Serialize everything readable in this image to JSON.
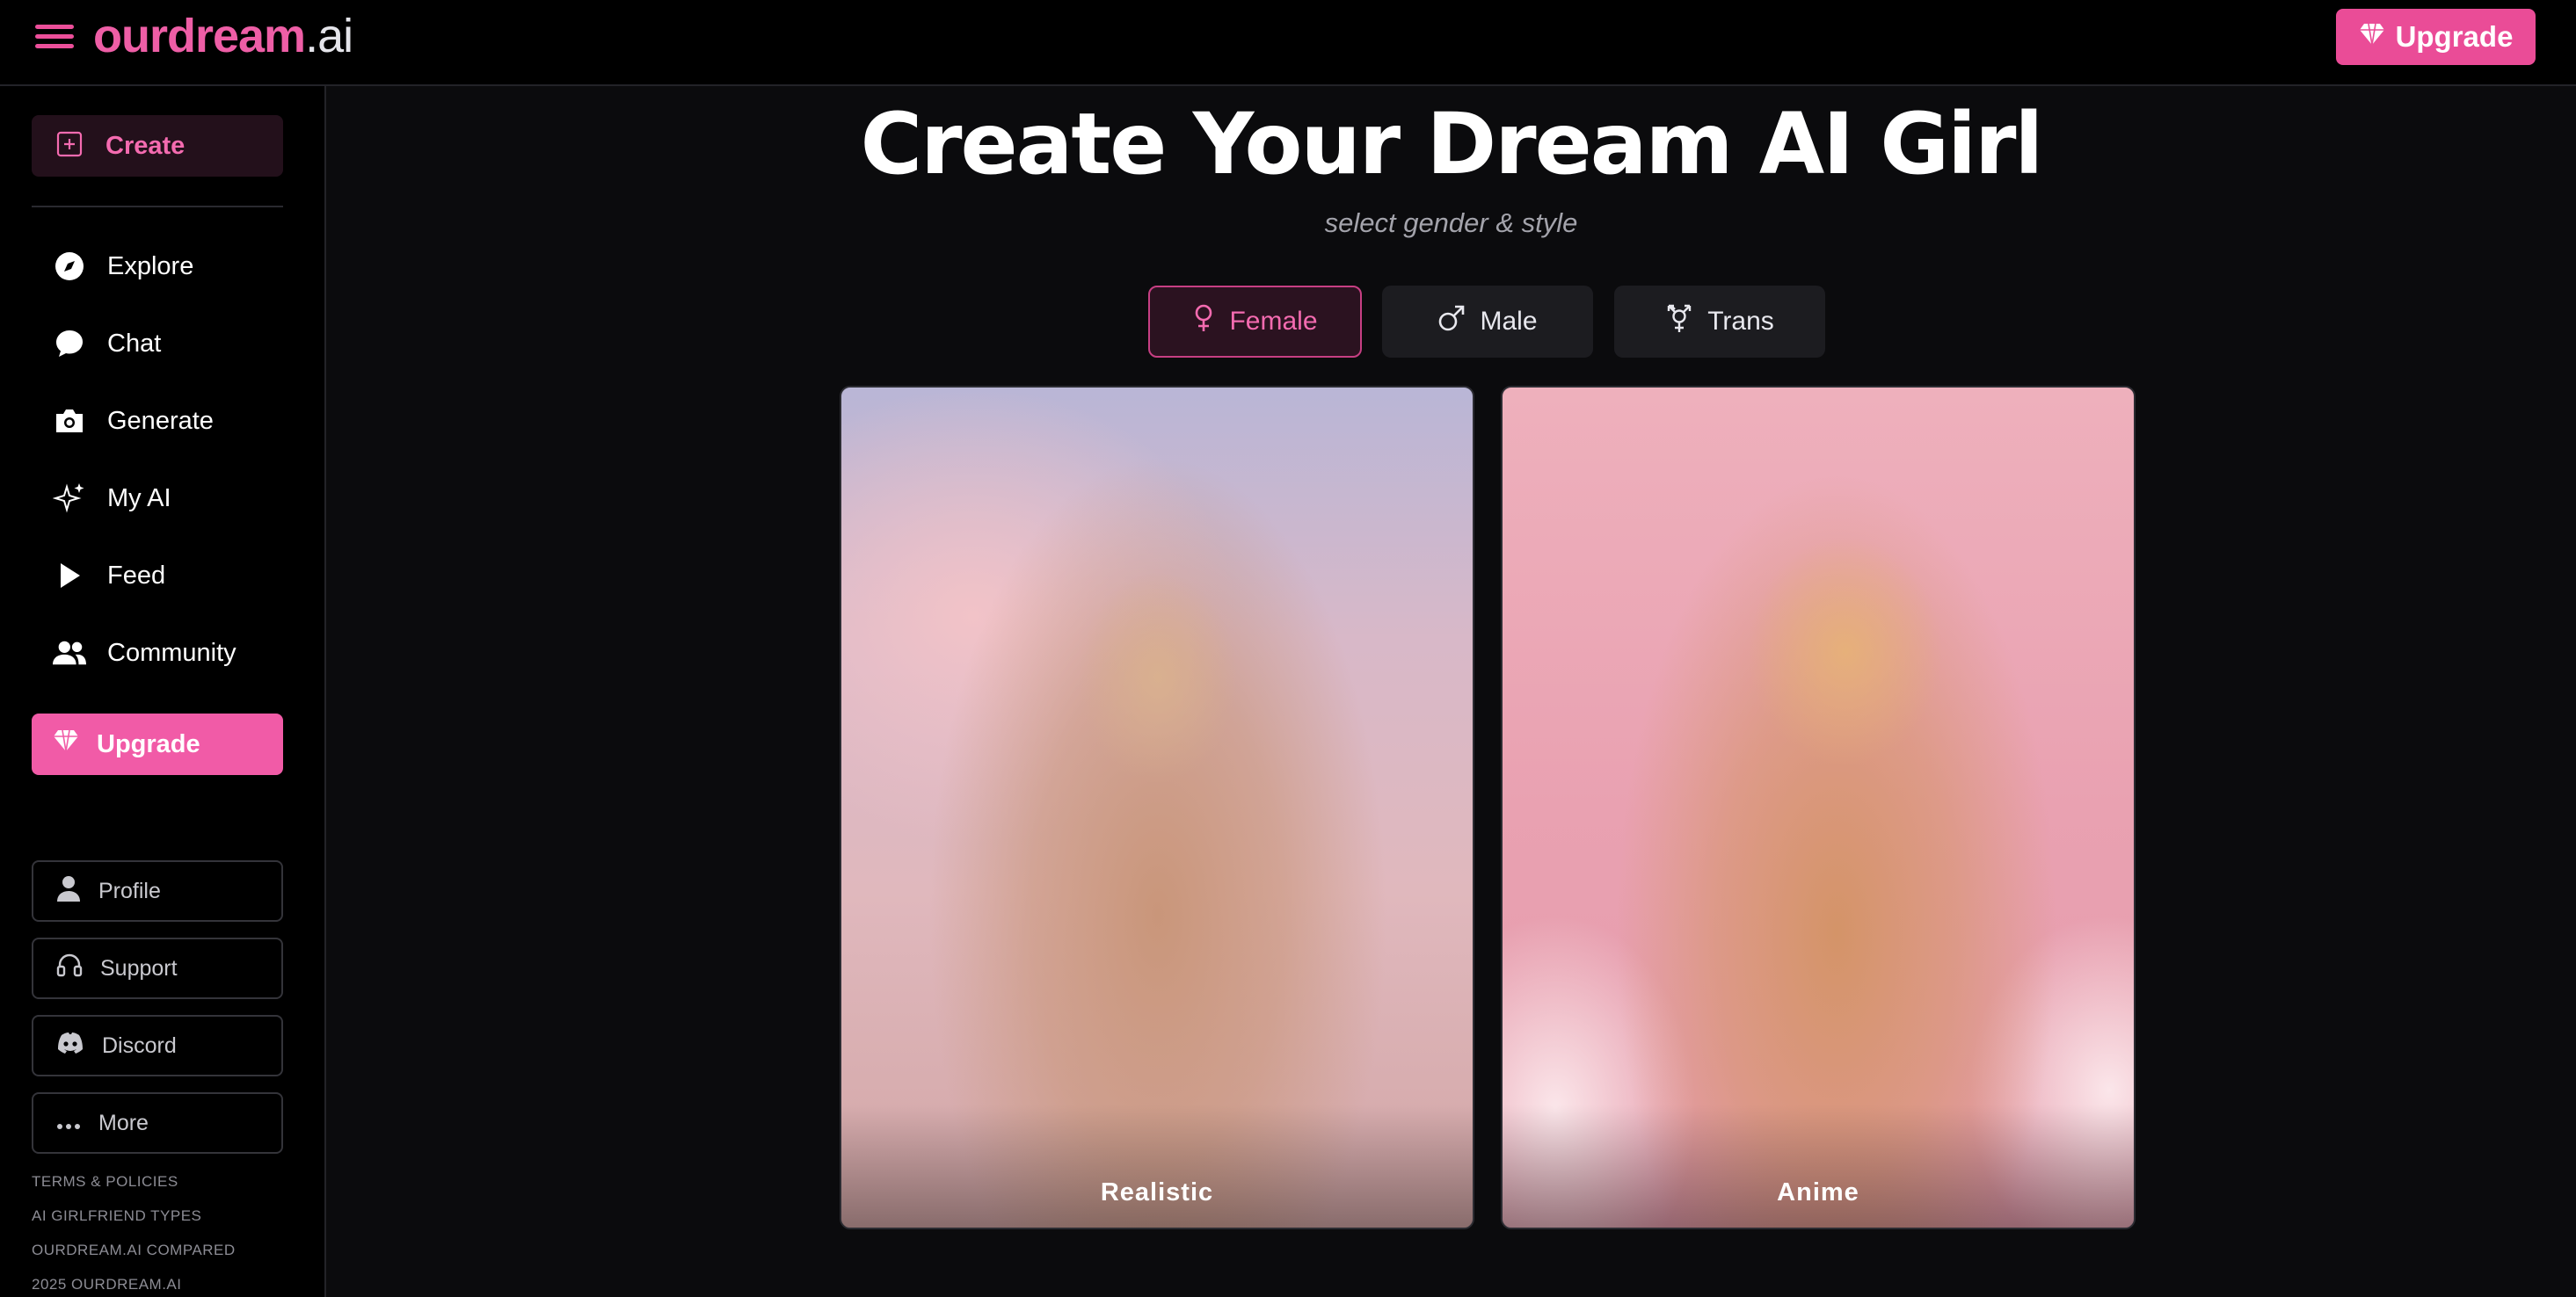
{
  "header": {
    "logo_main": "ourdream",
    "logo_tld": ".ai",
    "upgrade_label": "Upgrade"
  },
  "sidebar": {
    "create_label": "Create",
    "nav": [
      {
        "label": "Explore",
        "icon": "compass-icon"
      },
      {
        "label": "Chat",
        "icon": "chat-bubble-icon"
      },
      {
        "label": "Generate",
        "icon": "camera-icon"
      },
      {
        "label": "My AI",
        "icon": "sparkle-icon"
      },
      {
        "label": "Feed",
        "icon": "play-icon"
      },
      {
        "label": "Community",
        "icon": "users-icon"
      }
    ],
    "upgrade_label": "Upgrade",
    "secondary": [
      {
        "label": "Profile",
        "icon": "person-icon"
      },
      {
        "label": "Support",
        "icon": "headset-icon"
      },
      {
        "label": "Discord",
        "icon": "discord-icon"
      },
      {
        "label": "More",
        "icon": "more-dots-icon"
      }
    ],
    "footer_links": [
      "TERMS & POLICIES",
      "AI GIRLFRIEND TYPES",
      "OURDREAM.AI COMPARED",
      "2025 OURDREAM.AI"
    ]
  },
  "main": {
    "title": "Create Your Dream AI Girl",
    "subtitle": "select gender & style",
    "gender_tabs": [
      {
        "label": "Female",
        "icon": "female-symbol-icon",
        "selected": true
      },
      {
        "label": "Male",
        "icon": "male-symbol-icon",
        "selected": false
      },
      {
        "label": "Trans",
        "icon": "trans-symbol-icon",
        "selected": false
      }
    ],
    "styles": [
      {
        "label": "Realistic"
      },
      {
        "label": "Anime"
      }
    ]
  },
  "colors": {
    "accent": "#ea4c97",
    "accent_light": "#f46bb0",
    "background": "#0b0b0d",
    "sidebar_bg": "#000000"
  }
}
